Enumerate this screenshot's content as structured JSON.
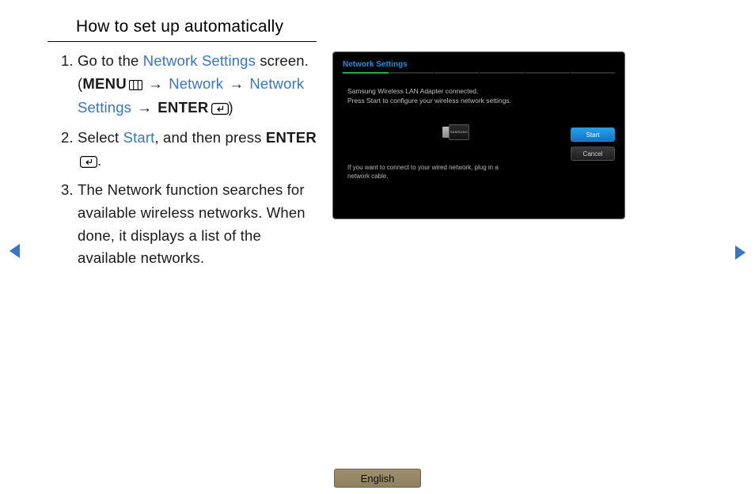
{
  "title": "How to set up automatically",
  "steps": {
    "s1": {
      "pre": "Go to the ",
      "link1": "Network Settings",
      "post1": " screen. (",
      "menu_label": "MENU",
      "arrow": "→",
      "link2": "Network",
      "link3": "Network Settings",
      "enter_label": "ENTER",
      "close": ")"
    },
    "s2": {
      "pre": "Select ",
      "link1": "Start",
      "post1": ", and then press ",
      "enter_label": "ENTER",
      "close": "."
    },
    "s3": {
      "text": "The Network function searches for available wireless networks. When done, it displays a list of the available networks."
    }
  },
  "screenshot": {
    "title": "Network Settings",
    "msg_line1": "Samsung Wireless LAN Adapter connected.",
    "msg_line2": "Press Start to configure your wireless network settings.",
    "adapter_brand": "SAMSUNG",
    "note_line1": "If you want to connect to your wired network, plug in a",
    "note_line2": "network cable.",
    "btn_start": "Start",
    "btn_cancel": "Cancel"
  },
  "footer": {
    "language": "English"
  }
}
